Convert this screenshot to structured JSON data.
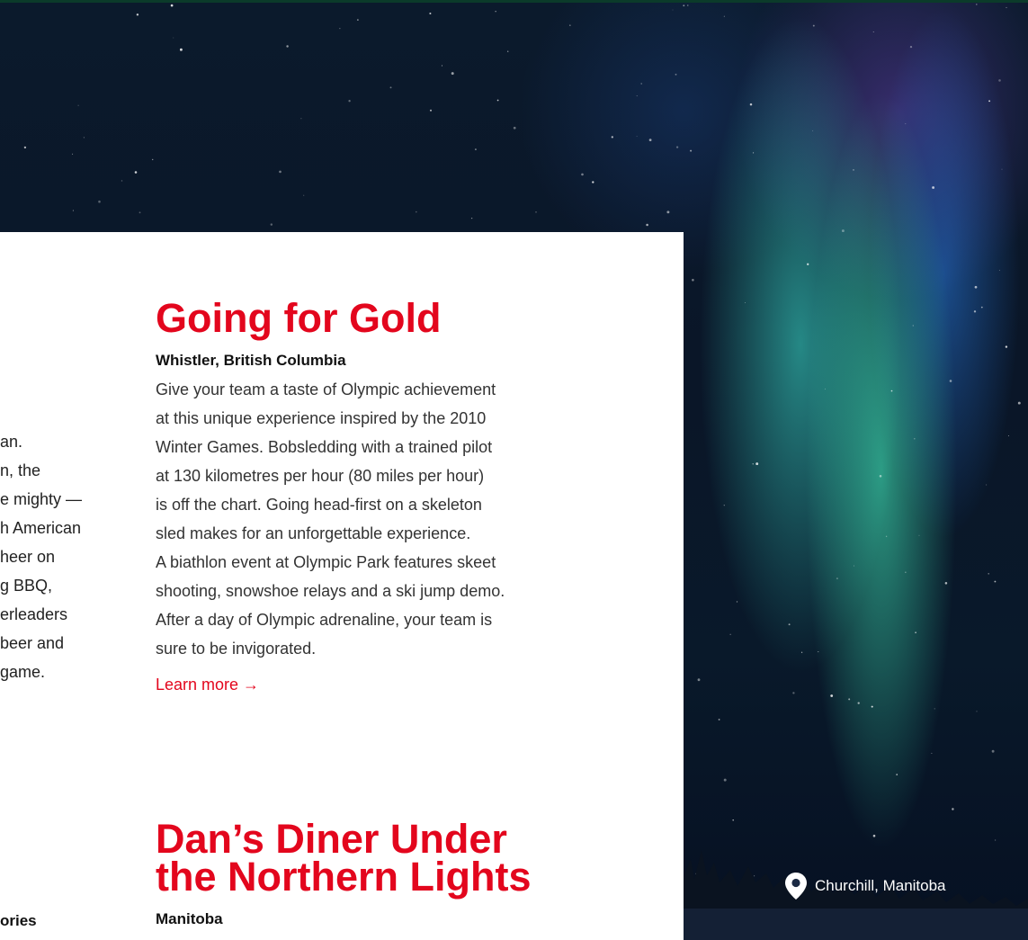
{
  "colors": {
    "accent": "#e3061d",
    "text": "#333333",
    "top_strip": "#0b3b2a"
  },
  "left_partial": {
    "body_lines": [
      "an.",
      "n, the",
      "e mighty —",
      "h American",
      "heer on",
      "g BBQ,",
      "erleaders",
      "beer and",
      "game."
    ],
    "category_label": "ories"
  },
  "articles": [
    {
      "title": "Going for Gold",
      "location": "Whistler, British Columbia",
      "description_lines": [
        "Give your team a taste of Olympic achievement",
        "at this unique experience inspired by the 2010",
        "Winter Games. Bobsledding with a trained pilot",
        "at 130 kilometres per hour (80 miles per hour)",
        "is off the chart. Going head-first on a skeleton",
        "sled makes for an unforgettable experience.",
        "A biathlon event at Olympic Park features skeet",
        "shooting, snowshoe relays and a ski jump demo.",
        "After a day of Olympic adrenaline, your team is",
        "sure to be invigorated."
      ],
      "link": "Learn more →"
    },
    {
      "title_lines": [
        "Dan’s Diner Under",
        "the Northern Lights"
      ],
      "location": "Manitoba"
    }
  ],
  "image_caption": {
    "icon": "location-pin-icon",
    "text": "Churchill, Manitoba"
  }
}
